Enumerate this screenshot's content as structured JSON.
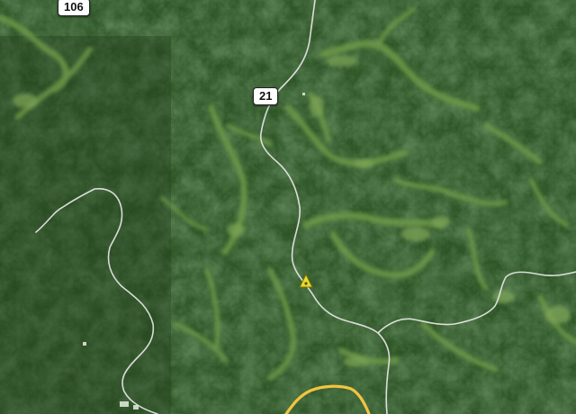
{
  "map": {
    "view": "satellite",
    "road_shields": [
      {
        "label": "106"
      },
      {
        "label": "21"
      }
    ],
    "colors": {
      "forest_dark": "#1f3a1a",
      "forest": "#2d5426",
      "valley": "#4f7a3a",
      "clearing": "#7fa656",
      "road": "#e8e8e8",
      "highway": "#f2c440",
      "marker": "#e8dc2a"
    }
  }
}
